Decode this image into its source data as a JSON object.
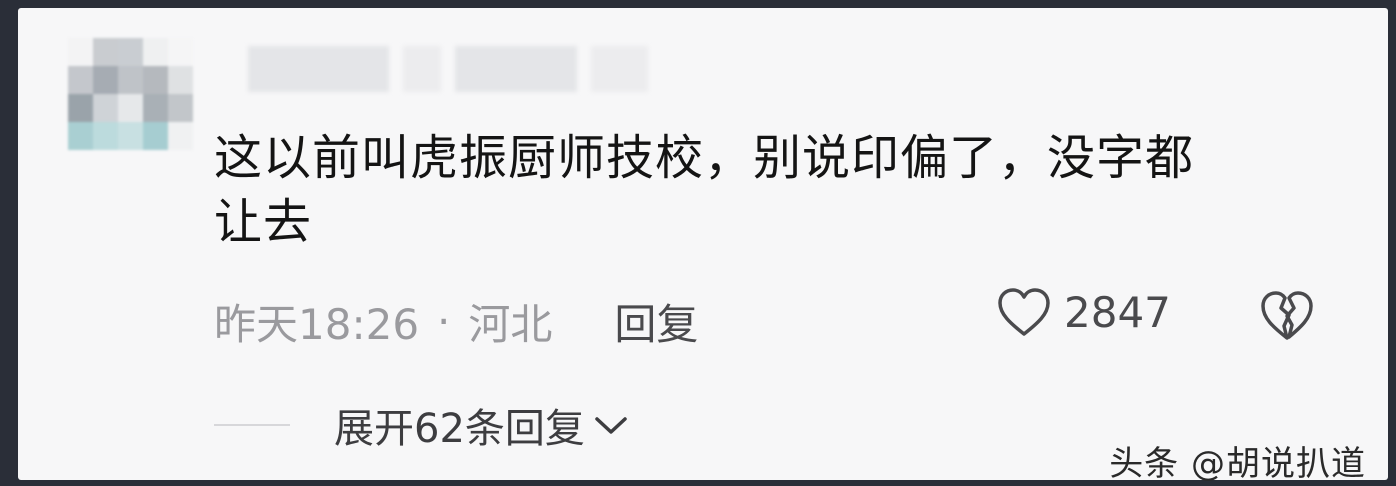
{
  "comment": {
    "text_line1": "这以前叫虎振厨师技校，别说印偏了，没字都",
    "text_line2": "让去"
  },
  "meta": {
    "time": "昨天18:26",
    "separator": "·",
    "location": "河北",
    "reply_label": "回复"
  },
  "like": {
    "count": "2847",
    "icon": "heart-outline-icon"
  },
  "dislike": {
    "icon": "broken-heart-icon"
  },
  "expand": {
    "label": "展开62条回复",
    "icon": "chevron-down-icon"
  },
  "watermark": {
    "text": "头条 @胡说扒道"
  },
  "colors": {
    "text_primary": "#141414",
    "text_meta": "#9a9a9e",
    "card_bg": "#f7f7f8"
  }
}
